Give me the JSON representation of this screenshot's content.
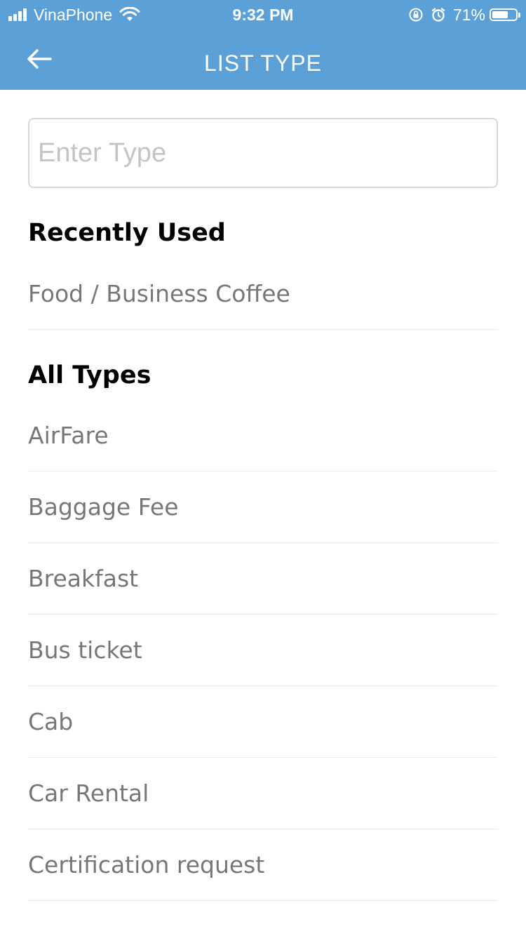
{
  "status_bar": {
    "carrier": "VinaPhone",
    "time": "9:32 PM",
    "battery_percent": "71%",
    "battery_level": 0.71,
    "icons": [
      "signal-icon",
      "wifi-icon",
      "rotation-lock-icon",
      "alarm-icon",
      "battery-icon"
    ]
  },
  "nav": {
    "title": "LIST TYPE",
    "back_icon": "back-arrow-icon"
  },
  "search": {
    "value": "",
    "placeholder": "Enter Type"
  },
  "recently_used": {
    "heading": "Recently Used",
    "items": [
      {
        "label": "Food / Business Coffee"
      }
    ]
  },
  "all_types": {
    "heading": "All Types",
    "items": [
      {
        "label": "AirFare"
      },
      {
        "label": "Baggage Fee"
      },
      {
        "label": "Breakfast"
      },
      {
        "label": "Bus ticket"
      },
      {
        "label": "Cab"
      },
      {
        "label": "Car Rental"
      },
      {
        "label": "Certification request"
      }
    ]
  },
  "colors": {
    "header_bg": "#5ba1d7",
    "header_text": "#ffffff",
    "item_text": "#777777",
    "heading_text": "#000000",
    "divider": "#ebebeb"
  }
}
